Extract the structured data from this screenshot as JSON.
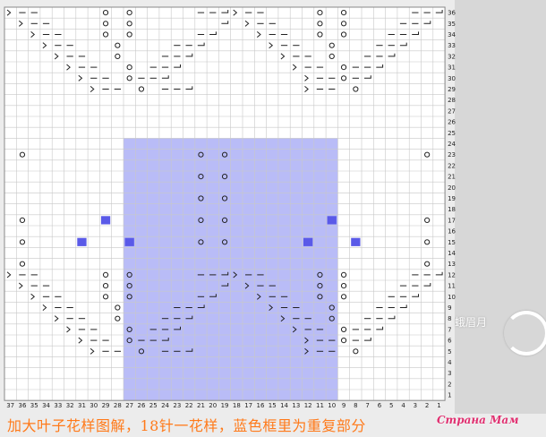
{
  "diagram": {
    "columns": 37,
    "rows": 36,
    "column_labels": [
      "37",
      "36",
      "35",
      "34",
      "33",
      "32",
      "31",
      "30",
      "29",
      "28",
      "27",
      "26",
      "25",
      "24",
      "23",
      "22",
      "21",
      "20",
      "19",
      "18",
      "17",
      "16",
      "15",
      "14",
      "13",
      "12",
      "11",
      "10",
      "9",
      "8",
      "7",
      "6",
      "5",
      "4",
      "3",
      "2",
      "1"
    ],
    "row_labels": [
      "36",
      "35",
      "34",
      "33",
      "32",
      "31",
      "30",
      "29",
      "28",
      "27",
      "26",
      "25",
      "24",
      "23",
      "22",
      "21",
      "20",
      "19",
      "18",
      "17",
      "16",
      "15",
      "14",
      "13",
      "12",
      "11",
      "10",
      "9",
      "8",
      "7",
      "6",
      "5",
      "4",
      "3",
      "2",
      "1"
    ],
    "repeat_region": {
      "from_column": 27,
      "to_column": 10,
      "from_row": 24,
      "to_row": 1,
      "color": "#b9bcf7"
    },
    "colors": {
      "grid": "#c8c8c8",
      "cell": "#ffffff",
      "marker": "#5a5ae8",
      "caption": "#ff7a1a",
      "badge": "#e03070"
    },
    "symbols": {
      "yo": "circle",
      "k2tog": "slash-right",
      "ssk": "slash-left",
      "no_stitch": "dash"
    }
  },
  "caption": "加大叶子花样图解，18针一花样，蓝色框里为重复部分",
  "watermark": "蛾眉月",
  "site_badge": "Страна Мам"
}
